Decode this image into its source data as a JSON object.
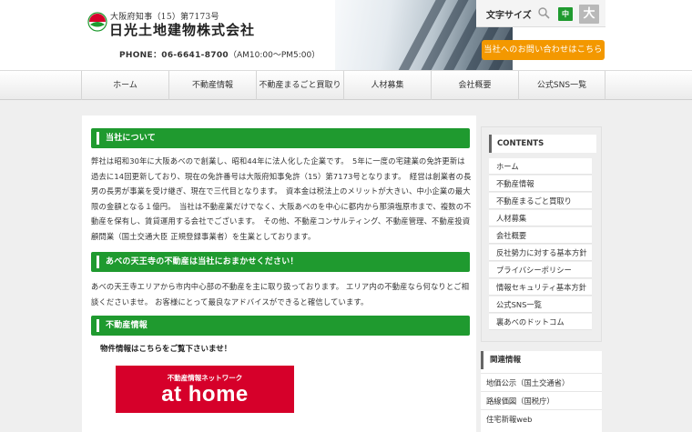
{
  "header": {
    "license_line": "大阪府知事（15）第7173号",
    "company_name": "日光土地建物株式会社",
    "phone_label": "PHONE：",
    "phone_number": "06-6641-8700",
    "hours": "（AM10:00〜PM5:00）",
    "contact_button": "当社へのお問い合わせはこちら",
    "text_size": {
      "label": "文字サイズ",
      "medium": "中",
      "large": "大"
    }
  },
  "nav": {
    "items": [
      "ホーム",
      "不動産情報",
      "不動産まるごと買取り",
      "人材募集",
      "会社概要",
      "公式SNS一覧"
    ]
  },
  "main": {
    "about": {
      "heading": "当社について",
      "body": "弊社は昭和30年に大阪あべので創業し、昭和44年に法人化した企業です。　5年に一度の宅建業の免許更新は過去に14回更新しており、現在の免許番号は大阪府知事免許（15）第7173号となります。　経営は創業者の長男の長男が事業を受け継ぎ、現在で三代目となります。　資本金は税法上のメリットが大きい、中小企業の最大限の金額となる１億円。　当社は不動産業だけでなく、大阪あべのを中心に都内から那須塩原市まで、複数の不動産を保有し、賃貸運用する会社でございます。　その他、不動産コンサルティング、不動産管理、不動産投資顧問業（国土交通大臣 正規登録事業者）を生業としております。"
    },
    "area": {
      "heading": "あべの天王寺の不動産は当社におまかせください！",
      "body": "あべの天王寺エリアから市内中心部の不動産を主に取り扱っております。 エリア内の不動産なら何なりとご相談くださいませ。 お客様にとって最良なアドバイスができると確信しています。"
    },
    "realestate": {
      "heading": "不動産情報",
      "subheading": "物件情報はこちらをご覧下さいませ！",
      "banner_caption": "不動産情報ネットワーク",
      "banner_brand": "at home"
    }
  },
  "sidebar": {
    "contents_title": "CONTENTS",
    "contents": [
      "ホーム",
      "不動産情報",
      "不動産まるごと買取り",
      "人材募集",
      "会社概要",
      "反社勢力に対する基本方針",
      "プライバシーポリシー",
      "情報セキュリティ基本方針",
      "公式SNS一覧",
      "裏あべのドットコム"
    ],
    "related_title": "関連情報",
    "related": [
      "地価公示（国土交通省）",
      "路線価図（国税庁）",
      "住宅新報web"
    ]
  },
  "colors": {
    "brand_green": "#1f9a2f",
    "accent_orange": "#f39800",
    "athome_red": "#d6002a"
  }
}
